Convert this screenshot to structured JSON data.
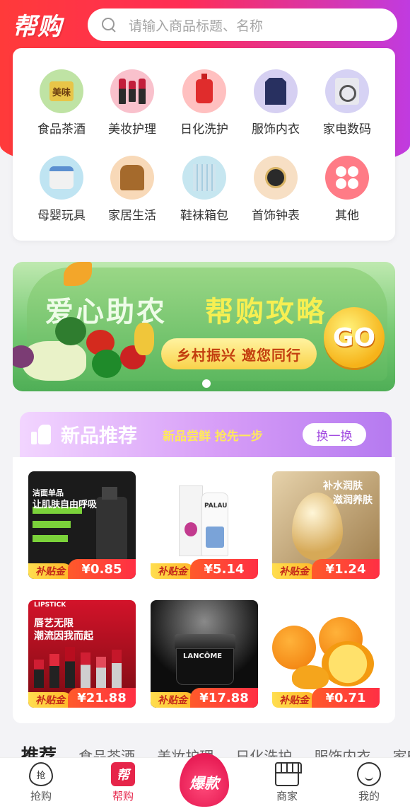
{
  "header": {
    "logo": "帮购",
    "search_placeholder": "请输入商品标题、名称"
  },
  "categories": [
    {
      "label": "食品茶酒",
      "icon": "food-icon",
      "box_text": "美味"
    },
    {
      "label": "美妆护理",
      "icon": "cosmetics-icon"
    },
    {
      "label": "日化洗护",
      "icon": "detergent-icon"
    },
    {
      "label": "服饰内衣",
      "icon": "clothing-icon"
    },
    {
      "label": "家电数码",
      "icon": "washing-machine-icon"
    },
    {
      "label": "母婴玩具",
      "icon": "baby-formula-icon"
    },
    {
      "label": "家居生活",
      "icon": "armchair-icon"
    },
    {
      "label": "鞋袜箱包",
      "icon": "curtain-icon"
    },
    {
      "label": "首饰钟表",
      "icon": "watch-icon"
    },
    {
      "label": "其他",
      "icon": "other-icon"
    }
  ],
  "banner": {
    "title_left": "爱心助农",
    "title_right": "帮购攻略",
    "subtitle": "乡村振兴 邀您同行",
    "go": "GO"
  },
  "new_products": {
    "title": "新品推荐",
    "subtitle": "新品尝鲜 抢先一步",
    "refresh": "换一换",
    "subsidy_label": "补贴金",
    "items": [
      {
        "price": "¥0.85",
        "line1": "洁面单品",
        "line2": "让肌肤自由呼吸",
        "bg": "#1b1b1b"
      },
      {
        "price": "¥5.14",
        "brand": "PALAU",
        "bg": "#ffffff"
      },
      {
        "price": "¥1.24",
        "line1": "补水润肤",
        "line2": "滋润养肤",
        "bg": "#caa676"
      },
      {
        "price": "¥21.88",
        "line0": "LIPSTICK",
        "line1": "唇艺无限",
        "line2": "潮流因我而起",
        "bg": "#b5121e"
      },
      {
        "price": "¥17.88",
        "brand": "LANCÔME",
        "bg": "#101010"
      },
      {
        "price": "¥0.71",
        "bg": "#ffffff"
      }
    ]
  },
  "recommend_tabs": [
    "推荐",
    "食品茶酒",
    "美妆护理",
    "日化洗护",
    "服饰内衣",
    "家E"
  ],
  "bottom_nav": {
    "items": [
      {
        "label": "抢购",
        "glyph": "抢"
      },
      {
        "label": "帮购",
        "glyph": "帮"
      },
      {
        "label": "商家"
      },
      {
        "label": "我的"
      }
    ],
    "center": "爆款"
  }
}
